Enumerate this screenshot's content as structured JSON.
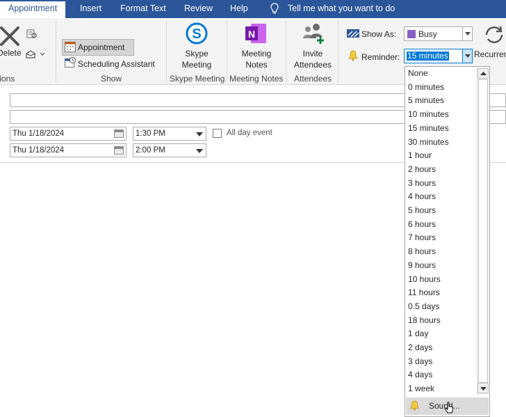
{
  "tabs": [
    "Appointment",
    "Insert",
    "Format Text",
    "Review",
    "Help"
  ],
  "tell_me": "Tell me what you want to do",
  "ribbon": {
    "delete_label": "Delete",
    "actions_group": "Actions",
    "show": {
      "appointment": "Appointment",
      "scheduling": "Scheduling Assistant",
      "group": "Show"
    },
    "skype": {
      "line1": "Skype",
      "line2": "Meeting",
      "group": "Skype Meeting"
    },
    "notes": {
      "line1": "Meeting",
      "line2": "Notes",
      "group": "Meeting Notes"
    },
    "attendees": {
      "line1": "Invite",
      "line2": "Attendees",
      "group": "Attendees"
    },
    "options": {
      "show_as_label": "Show As:",
      "show_as_value": "Busy",
      "reminder_label": "Reminder:",
      "reminder_value": "15 minutes",
      "recurrence": "Recurrence"
    }
  },
  "form": {
    "start_date": "Thu 1/18/2024",
    "start_time": "1:30 PM",
    "end_date": "Thu 1/18/2024",
    "end_time": "2:00 PM",
    "all_day": "All day event"
  },
  "reminder_options": [
    "None",
    "0 minutes",
    "5 minutes",
    "10 minutes",
    "15 minutes",
    "30 minutes",
    "1 hour",
    "2 hours",
    "3 hours",
    "4 hours",
    "5 hours",
    "6 hours",
    "7 hours",
    "8 hours",
    "9 hours",
    "10 hours",
    "11 hours",
    "0.5 days",
    "18 hours",
    "1 day",
    "2 days",
    "3 days",
    "4 days",
    "1 week"
  ],
  "sound_label": "Sound...",
  "colors": {
    "accent": "#2b579a",
    "selection": "#0078d7",
    "busy": "#8661c5"
  }
}
